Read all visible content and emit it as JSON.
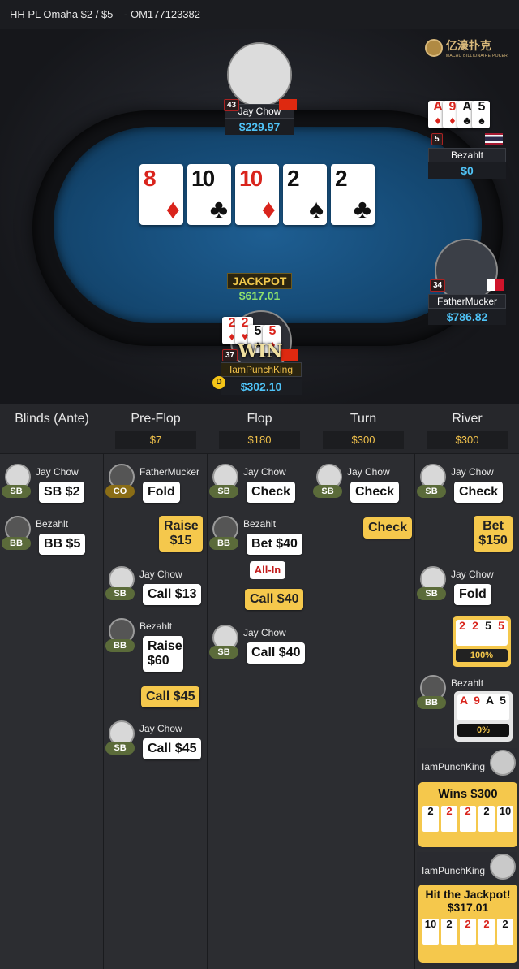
{
  "header": {
    "game": "HH PL Omaha $2 / $5",
    "hand_id": "- OM177123382"
  },
  "brand": {
    "name_cn": "亿濠扑克",
    "sub": "MACAU BILLIONAIRE POKER"
  },
  "board": [
    {
      "rank": "8",
      "suit": "♦",
      "color": "red"
    },
    {
      "rank": "10",
      "suit": "♣",
      "color": "blk"
    },
    {
      "rank": "10",
      "suit": "♦",
      "color": "red"
    },
    {
      "rank": "2",
      "suit": "♠",
      "color": "blk"
    },
    {
      "rank": "2",
      "suit": "♣",
      "color": "blk"
    }
  ],
  "jackpot": {
    "label": "JACKPOT",
    "value": "$617.01"
  },
  "seats": {
    "jay": {
      "name": "Jay Chow",
      "stack": "$229.97",
      "level": "43"
    },
    "bez": {
      "name": "Bezahlt",
      "stack": "$0",
      "level": "5",
      "cards": [
        "A",
        "9",
        "A",
        "5"
      ]
    },
    "fm": {
      "name": "FatherMucker",
      "stack": "$786.82",
      "level": "34"
    },
    "hero": {
      "name": "IamPunchKing",
      "stack": "$302.10",
      "level": "37",
      "cards": [
        "2",
        "2",
        "5",
        "5"
      ],
      "win": "WIN"
    }
  },
  "dealer_label": "D",
  "columns": [
    {
      "title": "Blinds (Ante)",
      "pot": ""
    },
    {
      "title": "Pre-Flop",
      "pot": "$7"
    },
    {
      "title": "Flop",
      "pot": "$180"
    },
    {
      "title": "Turn",
      "pot": "$300"
    },
    {
      "title": "River",
      "pot": "$300"
    }
  ],
  "names": {
    "jay": "Jay Chow",
    "bez": "Bezahlt",
    "fm": "FatherMucker",
    "hero": "IamPunchKing"
  },
  "pos": {
    "sb": "SB",
    "bb": "BB",
    "co": "CO"
  },
  "actions": {
    "blind_sb": "SB  $2",
    "blind_bb": "BB  $5",
    "pf_fold": "Fold",
    "pf_raise15": "Raise $15",
    "pf_call13": "Call  $13",
    "pf_raise60": "Raise $60",
    "pf_call45a": "Call  $45",
    "pf_call45b": "Call  $45",
    "fl_check": "Check",
    "fl_bet40": "Bet  $40",
    "fl_allin": "All-In",
    "fl_call40a": "Call  $40",
    "fl_call40b": "Call  $40",
    "tu_check1": "Check",
    "tu_check2": "Check",
    "rv_check": "Check",
    "rv_bet150": "Bet $150",
    "rv_fold": "Fold"
  },
  "river_hands": {
    "hero": {
      "cards": [
        "2",
        "2",
        "5",
        "5"
      ],
      "pct": "100%"
    },
    "bez": {
      "cards": [
        "A",
        "9",
        "A",
        "5"
      ],
      "pct": "0%"
    }
  },
  "results": {
    "win": {
      "text": "Wins $300",
      "cards": [
        "2",
        "2",
        "2",
        "2",
        "10"
      ]
    },
    "jackpot": {
      "text": "Hit the Jackpot!",
      "amount": "$317.01",
      "cards": [
        "10",
        "2",
        "2",
        "2",
        "2"
      ]
    }
  }
}
